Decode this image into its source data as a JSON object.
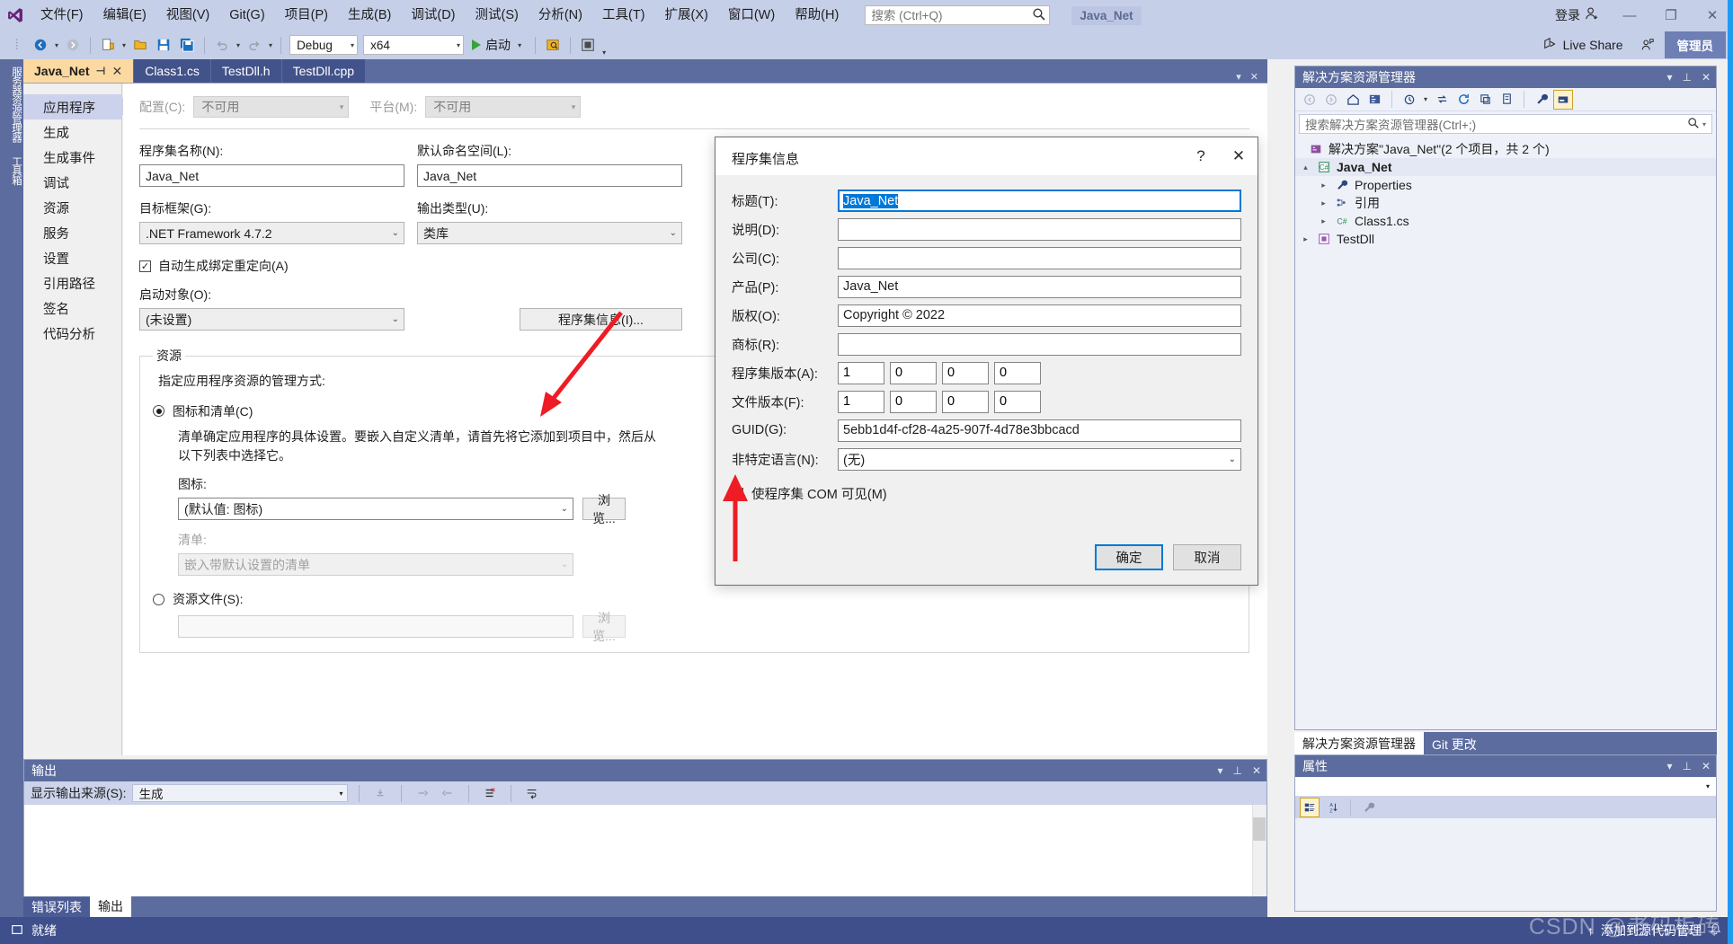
{
  "titlebar": {
    "menus": [
      "文件(F)",
      "编辑(E)",
      "视图(V)",
      "Git(G)",
      "项目(P)",
      "生成(B)",
      "调试(D)",
      "测试(S)",
      "分析(N)",
      "工具(T)",
      "扩展(X)",
      "窗口(W)",
      "帮助(H)"
    ],
    "search_placeholder": "搜索 (Ctrl+Q)",
    "solution_chip": "Java_Net",
    "signin_label": "登录",
    "minimize": "—",
    "maximize": "❐",
    "close": "✕"
  },
  "toolbar": {
    "config": "Debug",
    "platform": "x64",
    "run_label": "启动",
    "live_share": "Live Share",
    "admin_badge": "管理员"
  },
  "vertical_tabs": [
    "服务器资源管理器",
    "工具箱"
  ],
  "doc_tabs": [
    {
      "label": "Java_Net",
      "active": true
    },
    {
      "label": "Class1.cs",
      "active": false
    },
    {
      "label": "TestDll.h",
      "active": false
    },
    {
      "label": "TestDll.cpp",
      "active": false
    }
  ],
  "properties_page": {
    "side_tabs": [
      "应用程序",
      "生成",
      "生成事件",
      "调试",
      "资源",
      "服务",
      "设置",
      "引用路径",
      "签名",
      "代码分析"
    ],
    "active_side_tab": "应用程序",
    "config_label": "配置(C):",
    "config_value": "不可用",
    "platform_label": "平台(M):",
    "platform_value": "不可用",
    "assembly_name_label": "程序集名称(N):",
    "assembly_name_value": "Java_Net",
    "default_namespace_label": "默认命名空间(L):",
    "default_namespace_value": "Java_Net",
    "target_framework_label": "目标框架(G):",
    "target_framework_value": ".NET Framework 4.7.2",
    "output_type_label": "输出类型(U):",
    "output_type_value": "类库",
    "auto_binding_label": "自动生成绑定重定向(A)",
    "auto_binding_checked": "✓",
    "startup_object_label": "启动对象(O):",
    "startup_object_value": "(未设置)",
    "assembly_info_button": "程序集信息(I)...",
    "resources_group": "资源",
    "resources_hint": "指定应用程序资源的管理方式:",
    "icon_manifest_radio": "图标和清单(C)",
    "icon_manifest_desc": "清单确定应用程序的具体设置。要嵌入自定义清单，请首先将它添加到项目中，然后从以下列表中选择它。",
    "icon_label": "图标:",
    "icon_value": "(默认值: 图标)",
    "browse_label": "浏览...",
    "manifest_label": "清单:",
    "manifest_value": "嵌入带默认设置的清单",
    "resource_file_radio": "资源文件(S):",
    "resource_file_value": "",
    "browse_label2": "浏览..."
  },
  "dialog": {
    "title": "程序集信息",
    "help_icon": "?",
    "close_icon": "✕",
    "fields": [
      {
        "label": "标题(T):",
        "value": "Java_Net",
        "focused": true
      },
      {
        "label": "说明(D):",
        "value": ""
      },
      {
        "label": "公司(C):",
        "value": ""
      },
      {
        "label": "产品(P):",
        "value": "Java_Net"
      },
      {
        "label": "版权(O):",
        "value": "Copyright ©  2022"
      },
      {
        "label": "商标(R):",
        "value": ""
      }
    ],
    "assembly_version_label": "程序集版本(A):",
    "assembly_version": [
      "1",
      "0",
      "0",
      "0"
    ],
    "file_version_label": "文件版本(F):",
    "file_version": [
      "1",
      "0",
      "0",
      "0"
    ],
    "guid_label": "GUID(G):",
    "guid_value": "5ebb1d4f-cf28-4a25-907f-4d78e3bbcacd",
    "neutral_lang_label": "非特定语言(N):",
    "neutral_lang_value": "(无)",
    "com_visible_label": "使程序集 COM 可见(M)",
    "com_visible_checked": "✓",
    "ok_label": "确定",
    "cancel_label": "取消"
  },
  "solution_explorer": {
    "title": "解决方案资源管理器",
    "search_placeholder": "搜索解决方案资源管理器(Ctrl+;)",
    "tree": [
      {
        "indent": 0,
        "twisty": "",
        "icon": "sln",
        "label": "解决方案\"Java_Net\"(2 个项目，共 2 个)",
        "bold": false,
        "selected": false
      },
      {
        "indent": 0,
        "twisty": "▴",
        "icon": "cs",
        "label": "Java_Net",
        "bold": true,
        "selected": true
      },
      {
        "indent": 1,
        "twisty": "▸",
        "icon": "wrench",
        "label": "Properties",
        "bold": false,
        "selected": false
      },
      {
        "indent": 1,
        "twisty": "▸",
        "icon": "ref",
        "label": "引用",
        "bold": false,
        "selected": false
      },
      {
        "indent": 1,
        "twisty": "▸",
        "icon": "cs",
        "label": "Class1.cs",
        "bold": false,
        "selected": false
      },
      {
        "indent": 0,
        "twisty": "▸",
        "icon": "cpp",
        "label": "TestDll",
        "bold": false,
        "selected": false
      }
    ],
    "bottom_tabs": [
      {
        "label": "解决方案资源管理器",
        "active": true
      },
      {
        "label": "Git 更改",
        "active": false
      }
    ]
  },
  "properties_panel": {
    "title": "属性"
  },
  "output_panel": {
    "title": "输出",
    "source_label": "显示输出来源(S):",
    "source_value": "生成",
    "bottom_tabs": [
      {
        "label": "错误列表",
        "active": false
      },
      {
        "label": "输出",
        "active": true
      }
    ]
  },
  "statusbar": {
    "text": "就绪",
    "right_text": "添加到源代码管理",
    "up_icon": "↑"
  },
  "watermark": "CSDN @老码板砖",
  "colors": {
    "titlebar": "#c5cfe8",
    "panel_header": "#5c6c9e",
    "statusbar": "#3f4f8c",
    "accent": "#0078d7",
    "active_tab": "#fcd9a0",
    "arrow_red": "#ee1c25"
  }
}
